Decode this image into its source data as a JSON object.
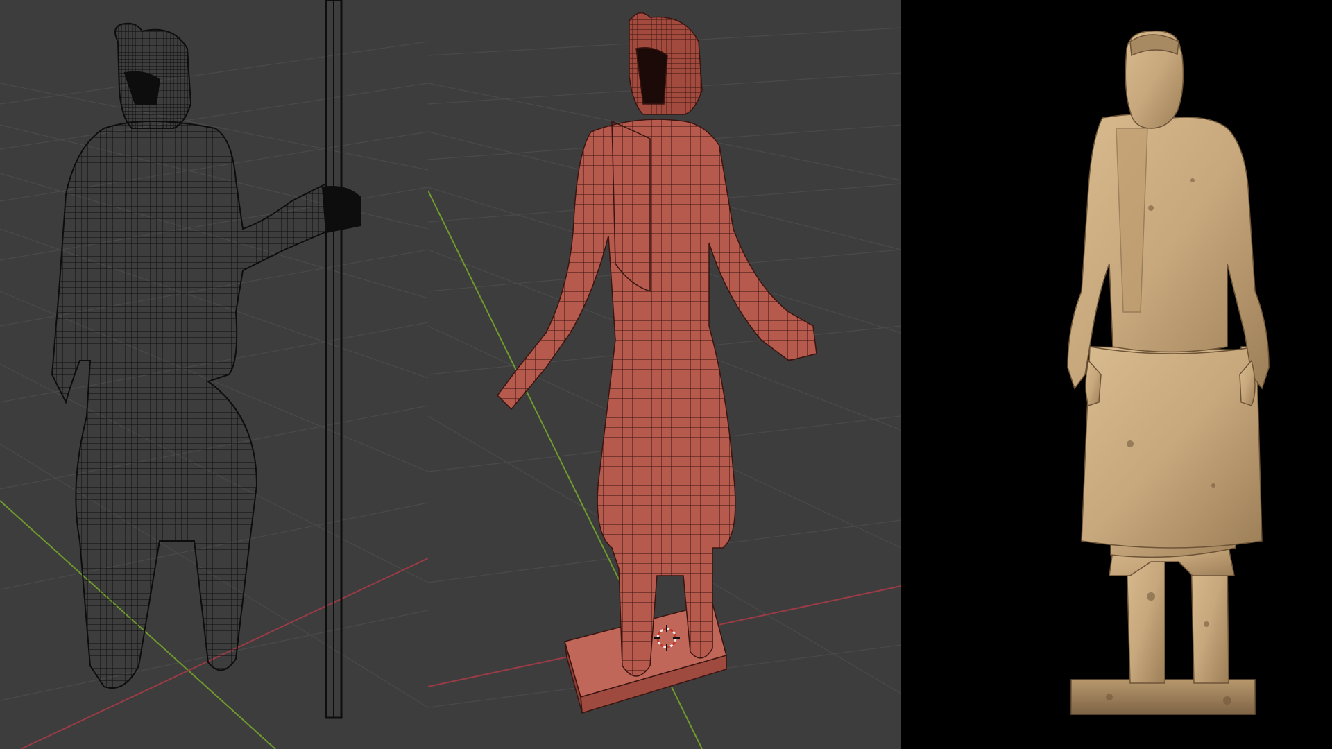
{
  "composition": {
    "panels": [
      {
        "id": "wireframe-viewport",
        "mode": "wireframe",
        "background": "#3d3d3d",
        "grid": true
      },
      {
        "id": "solid-viewport",
        "mode": "solid-with-wireframe",
        "background": "#3d3d3d",
        "grid": true
      },
      {
        "id": "final-render",
        "mode": "rendered",
        "background": "#000000",
        "grid": false
      }
    ]
  },
  "colors": {
    "viewport_bg": "#3d3d3d",
    "grid_line": "#4a4a4a",
    "x_axis": "#9a3b45",
    "y_axis": "#6f9a2c",
    "wire_black": "#0d0d0d",
    "clay_red": "#b55a4c",
    "clay_edge": "#3a1410",
    "terracotta": "#c7a77c",
    "render_bg": "#000000"
  },
  "icons": {
    "cursor": "3d-cursor-icon"
  },
  "subject": "terracotta-warrior-figure"
}
